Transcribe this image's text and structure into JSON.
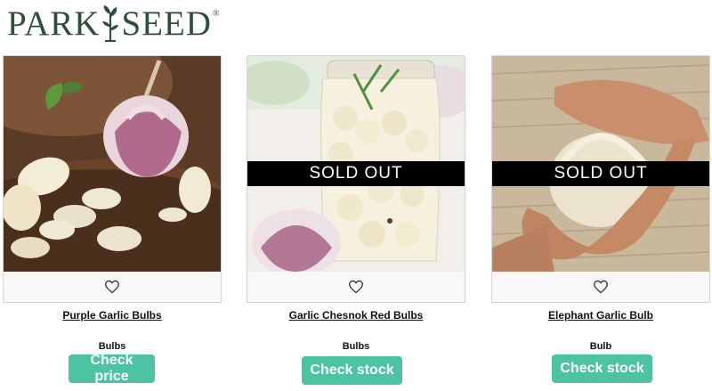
{
  "brand": {
    "logo_left": "PARK",
    "logo_right": "SEED",
    "registered_mark": "®"
  },
  "products": [
    {
      "name": "Purple Garlic Bulbs",
      "form": "Bulbs",
      "button": "Check price",
      "sold_out": ""
    },
    {
      "name": "Garlic Chesnok Red Bulbs",
      "form": "Bulbs",
      "button": "Check stock",
      "sold_out": "SOLD OUT"
    },
    {
      "name": "Elephant Garlic Bulb",
      "form": "Bulb",
      "button": "Check stock",
      "sold_out": "SOLD OUT"
    }
  ],
  "colors": {
    "brand_green": "#2d4f38",
    "button": "#4cc4a4",
    "sold_banner": "#000000"
  },
  "icons": {
    "wishlist": "heart-icon"
  }
}
